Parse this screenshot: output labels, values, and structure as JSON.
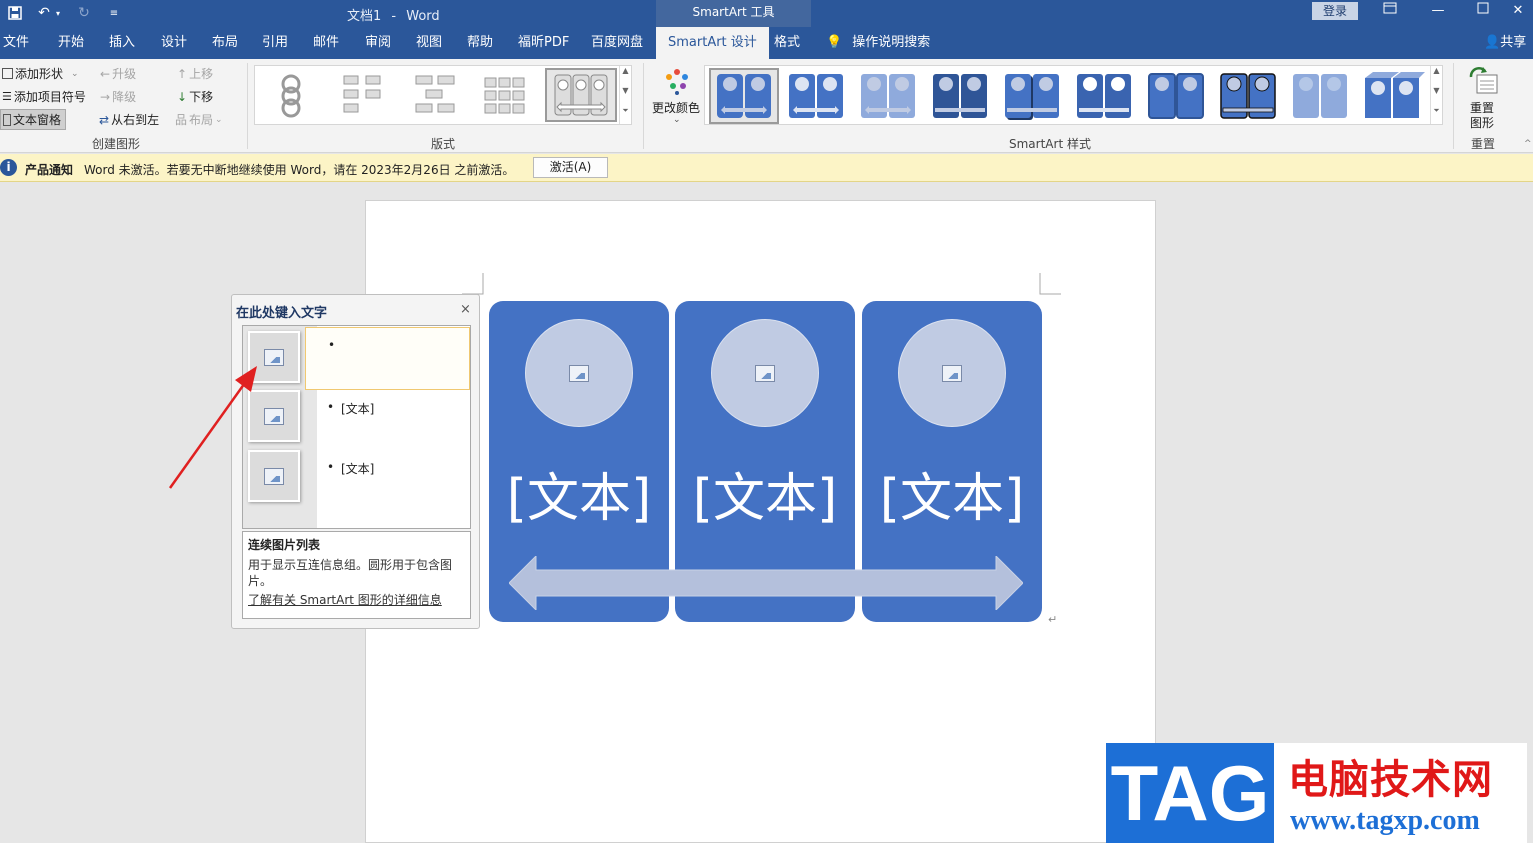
{
  "titlebar": {
    "document_name": "文档1",
    "separator": "-",
    "app_name": "Word",
    "contextual_header": "SmartArt 工具",
    "login_label": "登录"
  },
  "tabs": [
    "文件",
    "开始",
    "插入",
    "设计",
    "布局",
    "引用",
    "邮件",
    "审阅",
    "视图",
    "帮助",
    "福昕PDF",
    "百度网盘",
    "SmartArt 设计",
    "格式"
  ],
  "search_tab_label": "操作说明搜索",
  "share_label": "共享",
  "ribbon": {
    "create_graphic": {
      "add_shape": "添加形状",
      "add_bullet": "添加项目符号",
      "text_pane": "文本窗格",
      "promote": "升级",
      "demote": "降级",
      "right_to_left": "从右到左",
      "move_up": "上移",
      "move_down": "下移",
      "layout": "布局",
      "group_label": "创建图形"
    },
    "layouts_group_label": "版式",
    "change_colors_label": "更改颜色",
    "styles_group_label": "SmartArt 样式",
    "reset_graphic_label_1": "重置",
    "reset_graphic_label_2": "图形",
    "reset_group_label": "重置"
  },
  "notification": {
    "title": "产品通知",
    "message": "Word 未激活。若要无中断地继续使用 Word，请在 2023年2月26日 之前激活。",
    "button": "激活(A)"
  },
  "text_pane": {
    "title": "在此处键入文字",
    "close": "×",
    "items": [
      {
        "bullet": "•",
        "text": ""
      },
      {
        "bullet": "•",
        "text": "[文本]"
      },
      {
        "bullet": "•",
        "text": "[文本]"
      }
    ],
    "description_title": "连续图片列表",
    "description_body": "用于显示互连信息组。圆形用于包含图片。",
    "learn_more": "了解有关 SmartArt 图形的详细信息"
  },
  "smartart": {
    "panels": [
      {
        "text": "[文本]"
      },
      {
        "text": "[文本]"
      },
      {
        "text": "[文本]"
      }
    ],
    "colors": {
      "panel": "#4472c4",
      "circle": "#c0cbe3",
      "arrow": "#b4c0dc"
    }
  },
  "watermark": {
    "logo": "TAG",
    "title": "电脑技术网",
    "url": "www.tagxp.com"
  },
  "colors": {
    "word_blue": "#2b579a",
    "notification_bg": "#fcf4c6",
    "annotation_arrow": "#e02020"
  }
}
